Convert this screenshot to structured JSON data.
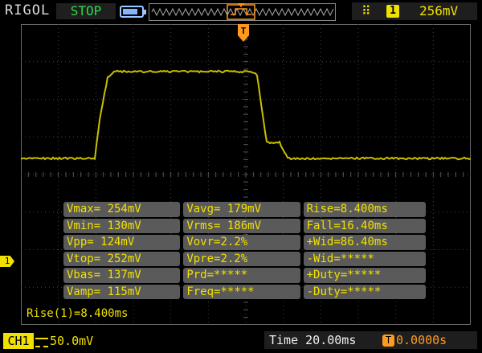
{
  "header": {
    "brand": "RIGOL",
    "run_state": "STOP",
    "battery_level": 0.8,
    "trigger_source": "1",
    "trigger_level": "256mV"
  },
  "measurements": [
    [
      "Vmax= 254mV",
      "Vavg= 179mV",
      "Rise=8.400ms"
    ],
    [
      "Vmin= 130mV",
      "Vrms= 186mV",
      "Fall=16.40ms"
    ],
    [
      "Vpp= 124mV",
      "Vovr=2.2%",
      "+Wid=86.40ms"
    ],
    [
      "Vtop= 252mV",
      "Vpre=2.2%",
      "-Wid=*****"
    ],
    [
      "Vbas= 137mV",
      "Prd=*****",
      "+Duty=*****"
    ],
    [
      "Vamp= 115mV",
      "Freq=*****",
      "-Duty=*****"
    ]
  ],
  "readout": "Rise(1)=8.400ms",
  "channel": {
    "name": "CH1",
    "scale": "50.0mV",
    "level_marker": "1"
  },
  "timebase": "Time 20.00ms",
  "trigger_offset": "0.0000s",
  "colors": {
    "trace": "#c8c000",
    "accent": "#f1e100",
    "grid": "#4a4a4a",
    "run": "#2fd94a",
    "trigger": "#ff9a1f"
  }
}
